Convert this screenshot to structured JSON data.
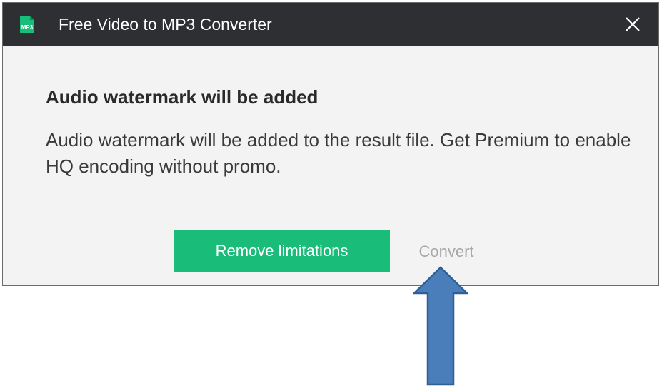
{
  "window": {
    "title": "Free Video to MP3 Converter",
    "app_icon_label": "MP3",
    "close_glyph": "✕"
  },
  "dialog": {
    "heading": "Audio watermark will be added",
    "message": "Audio watermark will be added to the result file. Get Premium to enable HQ encoding without promo."
  },
  "buttons": {
    "remove_limitations": "Remove limitations",
    "convert": "Convert"
  },
  "icons": {
    "app": "mp3-file-icon",
    "close": "close-icon",
    "annotation": "up-arrow-icon"
  },
  "colors": {
    "titlebar": "#2e2f33",
    "dialog_bg": "#f3f3f3",
    "primary_button": "#19bd79",
    "disabled_text": "#a7a7a7",
    "annotation_arrow": "#4a7ebb"
  }
}
